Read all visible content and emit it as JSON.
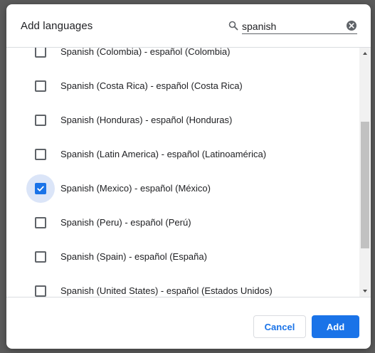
{
  "dialog": {
    "title": "Add languages"
  },
  "search": {
    "value": "spanish",
    "icon": "search-icon",
    "clear_icon": "clear-icon"
  },
  "languages": [
    {
      "label": "Spanish (Colombia) - español (Colombia)",
      "checked": false
    },
    {
      "label": "Spanish (Costa Rica) - español (Costa Rica)",
      "checked": false
    },
    {
      "label": "Spanish (Honduras) - español (Honduras)",
      "checked": false
    },
    {
      "label": "Spanish (Latin America) - español (Latinoamérica)",
      "checked": false
    },
    {
      "label": "Spanish (Mexico) - español (México)",
      "checked": true
    },
    {
      "label": "Spanish (Peru) - español (Perú)",
      "checked": false
    },
    {
      "label": "Spanish (Spain) - español (España)",
      "checked": false
    },
    {
      "label": "Spanish (United States) - español (Estados Unidos)",
      "checked": false
    }
  ],
  "footer": {
    "cancel_label": "Cancel",
    "add_label": "Add"
  },
  "colors": {
    "accent": "#1a73e8",
    "focus_ring": "#dbe5f8"
  }
}
